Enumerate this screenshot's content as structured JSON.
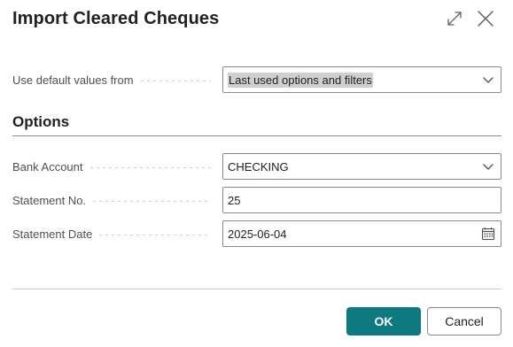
{
  "dialog": {
    "title": "Import Cleared Cheques",
    "expand_icon": "expand-diagonal-icon",
    "close_icon": "close-icon"
  },
  "defaults": {
    "label": "Use default values from",
    "value": "Last used options and filters",
    "icon": "chevron-down-icon"
  },
  "options": {
    "heading": "Options",
    "bank_account": {
      "label": "Bank Account",
      "value": "CHECKING",
      "icon": "chevron-down-icon"
    },
    "statement_no": {
      "label": "Statement No.",
      "value": "25"
    },
    "statement_date": {
      "label": "Statement Date",
      "value": "2025-06-04",
      "icon": "calendar-icon"
    }
  },
  "footer": {
    "ok_label": "OK",
    "cancel_label": "Cancel"
  },
  "colors": {
    "ok_button": "#0d7a7f",
    "text": "#212121",
    "label": "#505050",
    "border": "#8a8a8a",
    "selection": "#cfcfcf"
  }
}
